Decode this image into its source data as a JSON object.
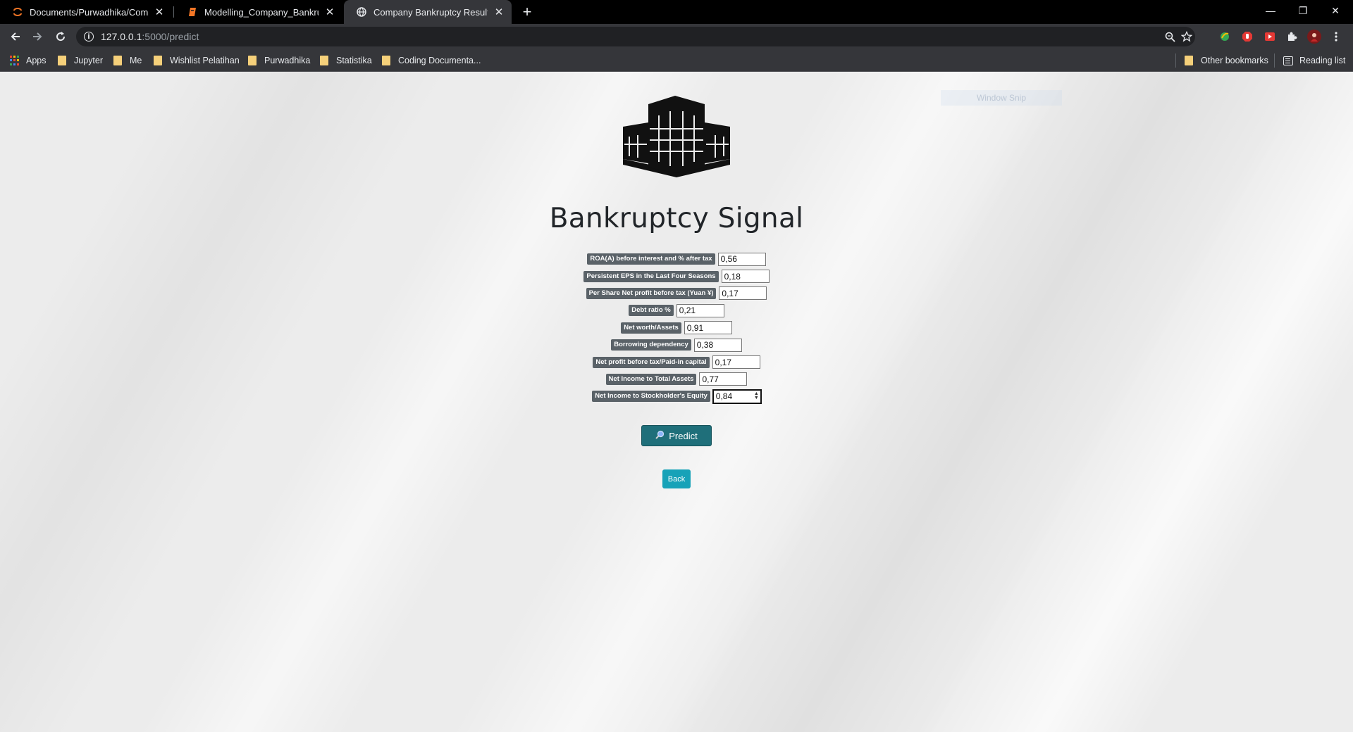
{
  "browser": {
    "tabs": [
      {
        "title": "Documents/Purwadhika/Compar",
        "icon": "jupyter-icon"
      },
      {
        "title": "Modelling_Company_Bankruptcy",
        "icon": "notebook-icon"
      },
      {
        "title": "Company Bankruptcy Result",
        "icon": "globe-icon",
        "active": true
      }
    ],
    "new_tab": "+",
    "url_host": "127.0.0.1",
    "url_path": ":5000/predict",
    "bookmarks": [
      {
        "label": "Apps",
        "type": "apps"
      },
      {
        "label": "Jupyter",
        "type": "folder"
      },
      {
        "label": "Me",
        "type": "folder"
      },
      {
        "label": "Wishlist Pelatihan",
        "type": "folder"
      },
      {
        "label": "Purwadhika",
        "type": "folder"
      },
      {
        "label": "Statistika",
        "type": "folder"
      },
      {
        "label": "Coding Documenta...",
        "type": "folder"
      }
    ],
    "other_bookmarks": "Other bookmarks",
    "reading_list": "Reading list"
  },
  "page": {
    "title": "Bankruptcy Signal",
    "overlay_text": "Window Snip",
    "fields": [
      {
        "label": "ROA(A) before interest and % after tax",
        "value": "0,56"
      },
      {
        "label": "Persistent EPS in the Last Four Seasons",
        "value": "0,18"
      },
      {
        "label": "Per Share Net profit before tax (Yuan ¥)",
        "value": "0,17"
      },
      {
        "label": "Debt ratio %",
        "value": "0,21"
      },
      {
        "label": "Net worth/Assets",
        "value": "0,91"
      },
      {
        "label": "Borrowing dependency",
        "value": "0,38"
      },
      {
        "label": "Net profit before tax/Paid-in capital",
        "value": "0,17"
      },
      {
        "label": "Net Income to Total Assets",
        "value": "0,77"
      },
      {
        "label": "Net Income to Stockholder's Equity",
        "value": "0,84",
        "focused": true
      }
    ],
    "predict_label": "Predict",
    "back_label": "Back",
    "colors": {
      "predict": "#1f6f7a",
      "back": "#17a2b8",
      "label_bg": "#5a6268"
    }
  }
}
